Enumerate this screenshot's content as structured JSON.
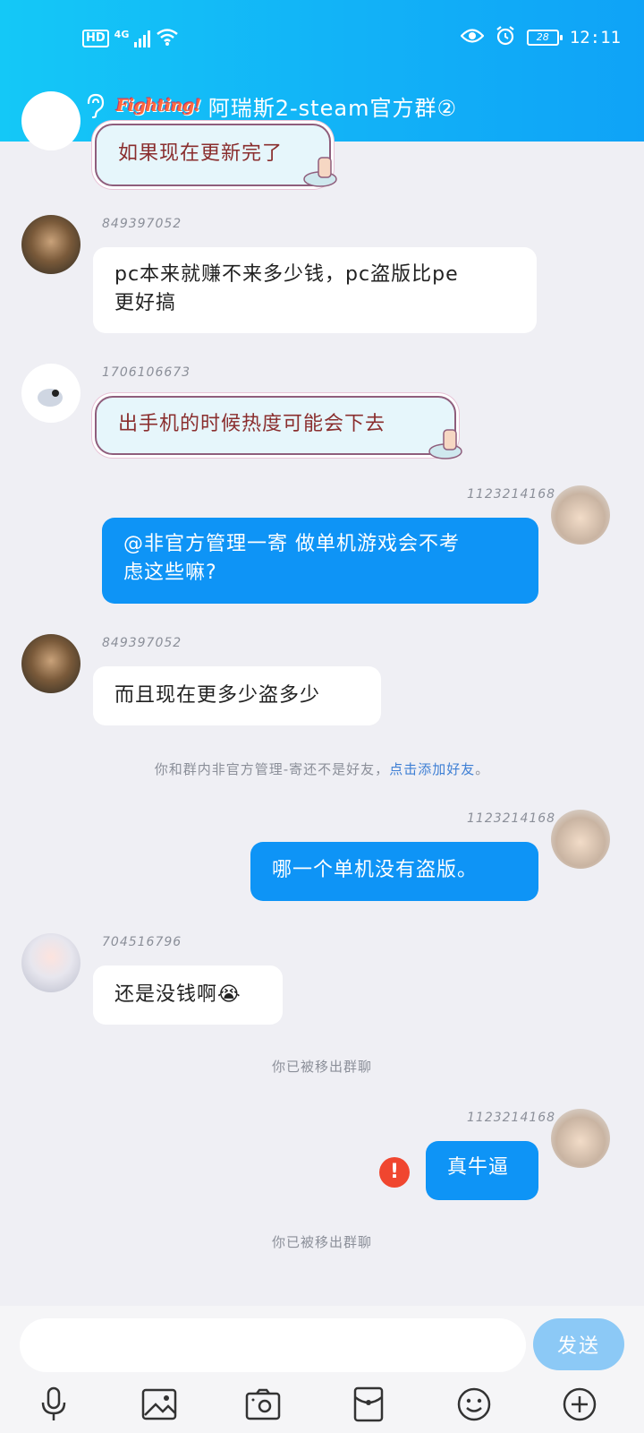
{
  "status_bar": {
    "hd": "HD",
    "network": "4G",
    "battery": "28",
    "time": "12:11"
  },
  "header": {
    "brand": "Fighting!",
    "title": "阿瑞斯2-steam官方群②"
  },
  "messages": [
    {
      "type": "incoming",
      "sender": "",
      "text": "如果现在更新完了",
      "style": "deco"
    },
    {
      "type": "incoming",
      "sender": "849397052",
      "text_lines": [
        "pc本来就赚不来多少钱，pc盗版比pe",
        "更好搞"
      ],
      "style": "white"
    },
    {
      "type": "incoming",
      "sender": "1706106673",
      "text": "出手机的时候热度可能会下去",
      "style": "deco"
    },
    {
      "type": "outgoing",
      "sender": "1123214168",
      "text_lines": [
        "@非官方管理一寄 做单机游戏会不考",
        "虑这些嘛?"
      ]
    },
    {
      "type": "incoming",
      "sender": "849397052",
      "text": "而且现在更多少盗多少",
      "style": "white"
    },
    {
      "type": "system",
      "text": "你和群内非官方管理-寄还不是好友，",
      "link": "点击添加好友",
      "suffix": "。"
    },
    {
      "type": "outgoing",
      "sender": "1123214168",
      "text": "哪一个单机没有盗版。"
    },
    {
      "type": "incoming",
      "sender": "704516796",
      "text": "还是没钱啊😭",
      "style": "white"
    },
    {
      "type": "system",
      "text": "你已被移出群聊"
    },
    {
      "type": "outgoing",
      "sender": "1123214168",
      "text": "真牛逼",
      "failed": true,
      "error_icon": "!"
    },
    {
      "type": "system",
      "text": "你已被移出群聊"
    }
  ],
  "input": {
    "placeholder": "",
    "send_label": "发送"
  },
  "colors": {
    "header": "#12b2f7",
    "outgoing_bubble": "#0e94f6",
    "send_button": "#8cc9f6",
    "error": "#f0462f"
  },
  "toolbar_icons": [
    "microphone-icon",
    "image-icon",
    "camera-icon",
    "red-packet-icon",
    "emoji-icon",
    "plus-icon"
  ]
}
